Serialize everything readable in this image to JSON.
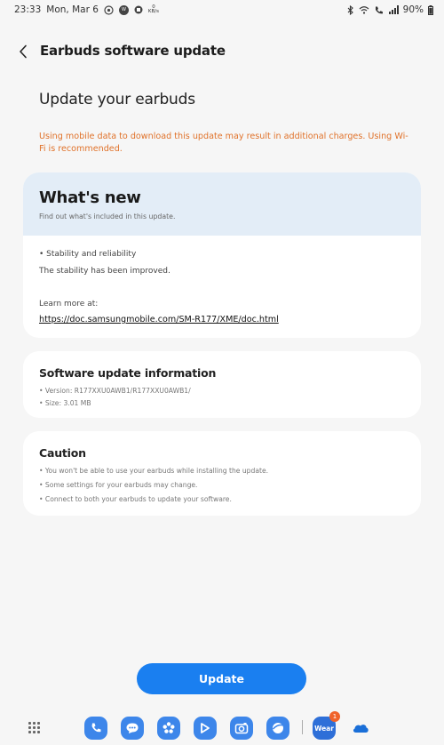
{
  "status_bar": {
    "time": "23:33",
    "date": "Mon, Mar 6",
    "kbps": "0\nKB/s",
    "battery": "90%"
  },
  "app_bar": {
    "title": "Earbuds software update",
    "back_icon": "back-arrow-icon"
  },
  "heading": "Update your earbuds",
  "warning": "Using mobile data to download this update may result in additional charges. Using Wi-Fi is recommended.",
  "whats_new": {
    "title": "What's new",
    "subtitle": "Find out what's included in this update.",
    "bullet": "• Stability and reliability",
    "description": "The stability has been improved.",
    "learn_more": "Learn more at:",
    "link": "https://doc.samsungmobile.com/SM-R177/XME/doc.html"
  },
  "software_info": {
    "title": "Software update information",
    "version": "• Version: R177XXU0AWB1/R177XXU0AWB1/",
    "size": "• Size: 3.01 MB"
  },
  "caution": {
    "title": "Caution",
    "items": [
      "• You won't be able to use your earbuds while installing the update.",
      "• Some settings for your earbuds may change.",
      "• Connect to both your earbuds to update your software."
    ]
  },
  "update_button": "Update",
  "taskbar": {
    "apps": [
      "phone-icon",
      "messages-icon",
      "bixby-icon",
      "galaxy-store-icon",
      "camera-icon",
      "internet-icon",
      "wear-icon",
      "onedrive-icon"
    ],
    "wear_label": "Wear",
    "wear_badge": "1"
  },
  "colors": {
    "accent": "#1a7ff0",
    "warning": "#e0722a",
    "header_bg": "#e3edf7",
    "background": "#f6f6f6"
  }
}
